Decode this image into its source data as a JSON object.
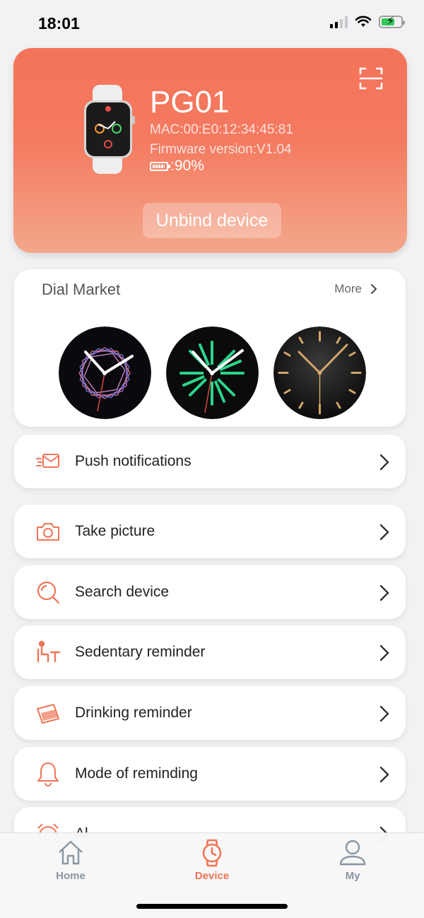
{
  "status_bar": {
    "time": "18:01"
  },
  "device": {
    "name": "PG01",
    "mac": "MAC:00:E0:12:34:45:81",
    "firmware": "Firmware version:V1.04",
    "battery": ":90%",
    "battery_level": 0.9,
    "unbind_label": "Unbind device"
  },
  "dial_market": {
    "title": "Dial Market",
    "more_label": "More"
  },
  "menu": [
    {
      "label": "Push notifications",
      "icon": "envelope-icon"
    },
    {
      "label": "Take picture",
      "icon": "camera-icon"
    },
    {
      "label": "Search device",
      "icon": "search-icon"
    },
    {
      "label": "Sedentary reminder",
      "icon": "sitting-person-icon"
    },
    {
      "label": "Drinking reminder",
      "icon": "water-cup-icon"
    },
    {
      "label": "Mode of reminding",
      "icon": "bell-icon"
    },
    {
      "label": "Al",
      "icon": "alarm-clock-icon"
    }
  ],
  "tabs": [
    {
      "label": "Home",
      "icon": "home-icon",
      "active": false
    },
    {
      "label": "Device",
      "icon": "watch-icon",
      "active": true
    },
    {
      "label": "My",
      "icon": "person-icon",
      "active": false
    }
  ],
  "colors": {
    "accent": "#ef7556",
    "tab_inactive": "#8a96a3",
    "card_top": "#f4735a",
    "card_bottom": "#f3a78a"
  }
}
